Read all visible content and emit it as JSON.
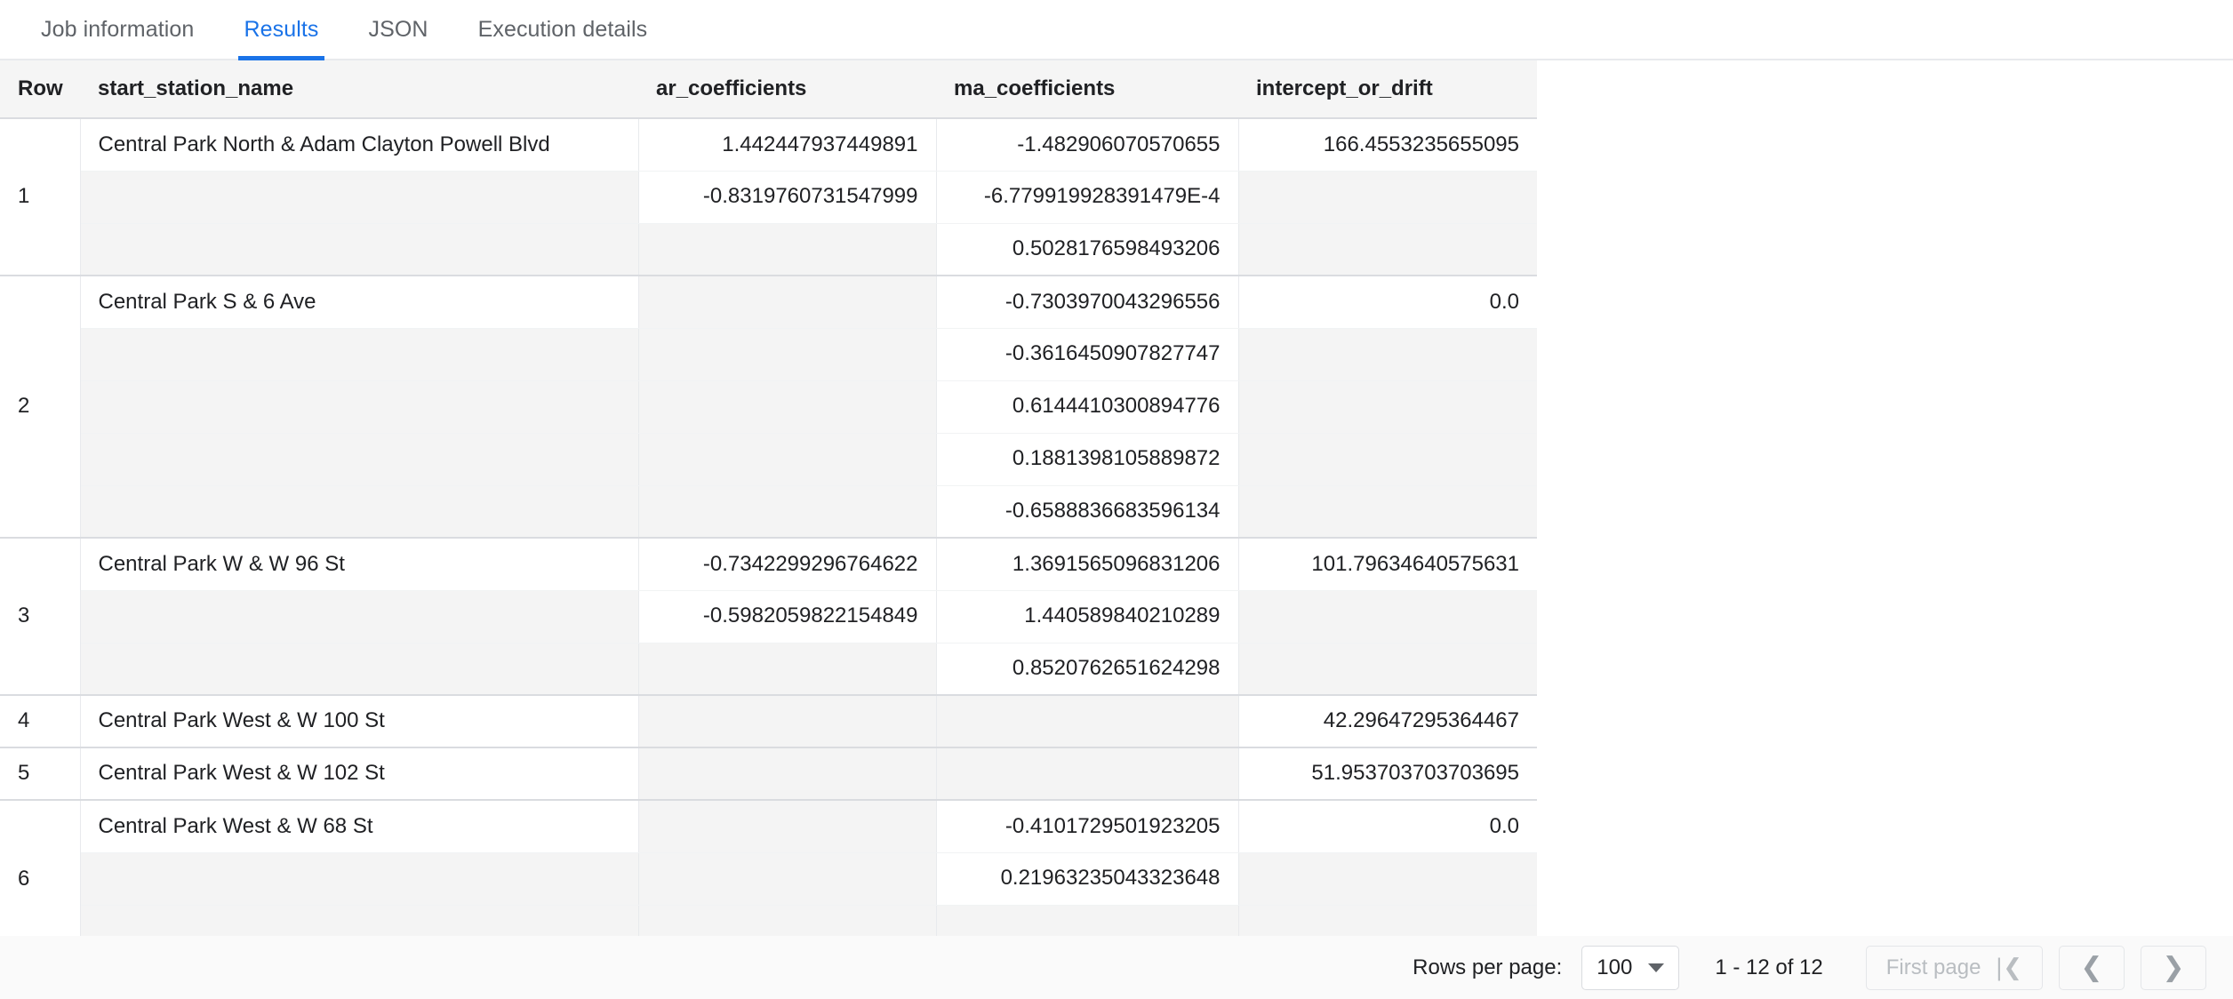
{
  "tabs": [
    {
      "label": "Job information",
      "active": false
    },
    {
      "label": "Results",
      "active": true
    },
    {
      "label": "JSON",
      "active": false
    },
    {
      "label": "Execution details",
      "active": false
    }
  ],
  "table": {
    "columns": [
      {
        "key": "row",
        "label": "Row",
        "align": "left"
      },
      {
        "key": "name",
        "label": "start_station_name",
        "align": "left"
      },
      {
        "key": "ar",
        "label": "ar_coefficients",
        "align": "left"
      },
      {
        "key": "ma",
        "label": "ma_coefficients",
        "align": "left"
      },
      {
        "key": "drift",
        "label": "intercept_or_drift",
        "align": "left"
      }
    ],
    "rows": [
      {
        "row": "1",
        "name": "Central Park North & Adam Clayton Powell Blvd",
        "ar": [
          "1.442447937449891",
          "-0.8319760731547999",
          ""
        ],
        "ma": [
          "-1.482906070570655",
          "-6.779919928391479E-4",
          "0.5028176598493206"
        ],
        "drift": "166.4553235655095"
      },
      {
        "row": "2",
        "name": "Central Park S & 6 Ave",
        "ar": [
          "",
          "",
          "",
          "",
          ""
        ],
        "ma": [
          "-0.7303970043296556",
          "-0.3616450907827747",
          "0.6144410300894776",
          "0.1881398105889872",
          "-0.6588836683596134"
        ],
        "drift": "0.0"
      },
      {
        "row": "3",
        "name": "Central Park W & W 96 St",
        "ar": [
          "-0.7342299296764622",
          "-0.5982059822154849",
          ""
        ],
        "ma": [
          "1.3691565096831206",
          "1.440589840210289",
          "0.8520762651624298"
        ],
        "drift": "101.79634640575631"
      },
      {
        "row": "4",
        "name": "Central Park West & W 100 St",
        "ar": [
          ""
        ],
        "ma": [
          ""
        ],
        "drift": "42.29647295364467"
      },
      {
        "row": "5",
        "name": "Central Park West & W 102 St",
        "ar": [
          ""
        ],
        "ma": [
          ""
        ],
        "drift": "51.953703703703695"
      },
      {
        "row": "6",
        "name": "Central Park West & W 68 St",
        "ar": [
          "",
          "",
          ""
        ],
        "ma": [
          "-0.4101729501923205",
          "0.21963235043323648",
          ""
        ],
        "drift": "0.0"
      }
    ]
  },
  "footer": {
    "rows_per_page_label": "Rows per page:",
    "rows_per_page_value": "100",
    "range_text": "1 - 12 of 12",
    "first_page_label": "First page",
    "first_page_icon": "first-page-icon",
    "prev_icon": "chevron-left-icon",
    "next_icon": "chevron-right-icon"
  },
  "colors": {
    "accent": "#1a73e8",
    "header_bg": "#f5f5f5",
    "empty_cell_bg": "#f4f4f4",
    "footer_bg": "#fafafa",
    "text": "#202124",
    "muted_text": "#5f6368"
  }
}
